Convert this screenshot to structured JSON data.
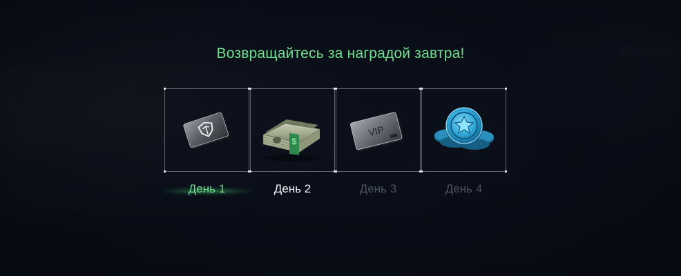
{
  "reward_screen": {
    "title": "Возвращайтесь за наградой завтра!",
    "days": [
      {
        "label": "День 1",
        "reward_icon": "emblem-card-icon",
        "state": "claimed"
      },
      {
        "label": "День 2",
        "reward_icon": "cash-stack-icon",
        "state": "next"
      },
      {
        "label": "День 3",
        "reward_icon": "vip-card-icon",
        "state": "locked",
        "card_text": "VIP"
      },
      {
        "label": "День 4",
        "reward_icon": "coin-stack-icon",
        "state": "locked"
      }
    ],
    "colors": {
      "accent_green": "#6fe08e",
      "active_white": "#f2f4f7",
      "locked_gray": "#4b5260",
      "background": "#0d1220",
      "coin_blue": "#2fa6d6"
    }
  }
}
